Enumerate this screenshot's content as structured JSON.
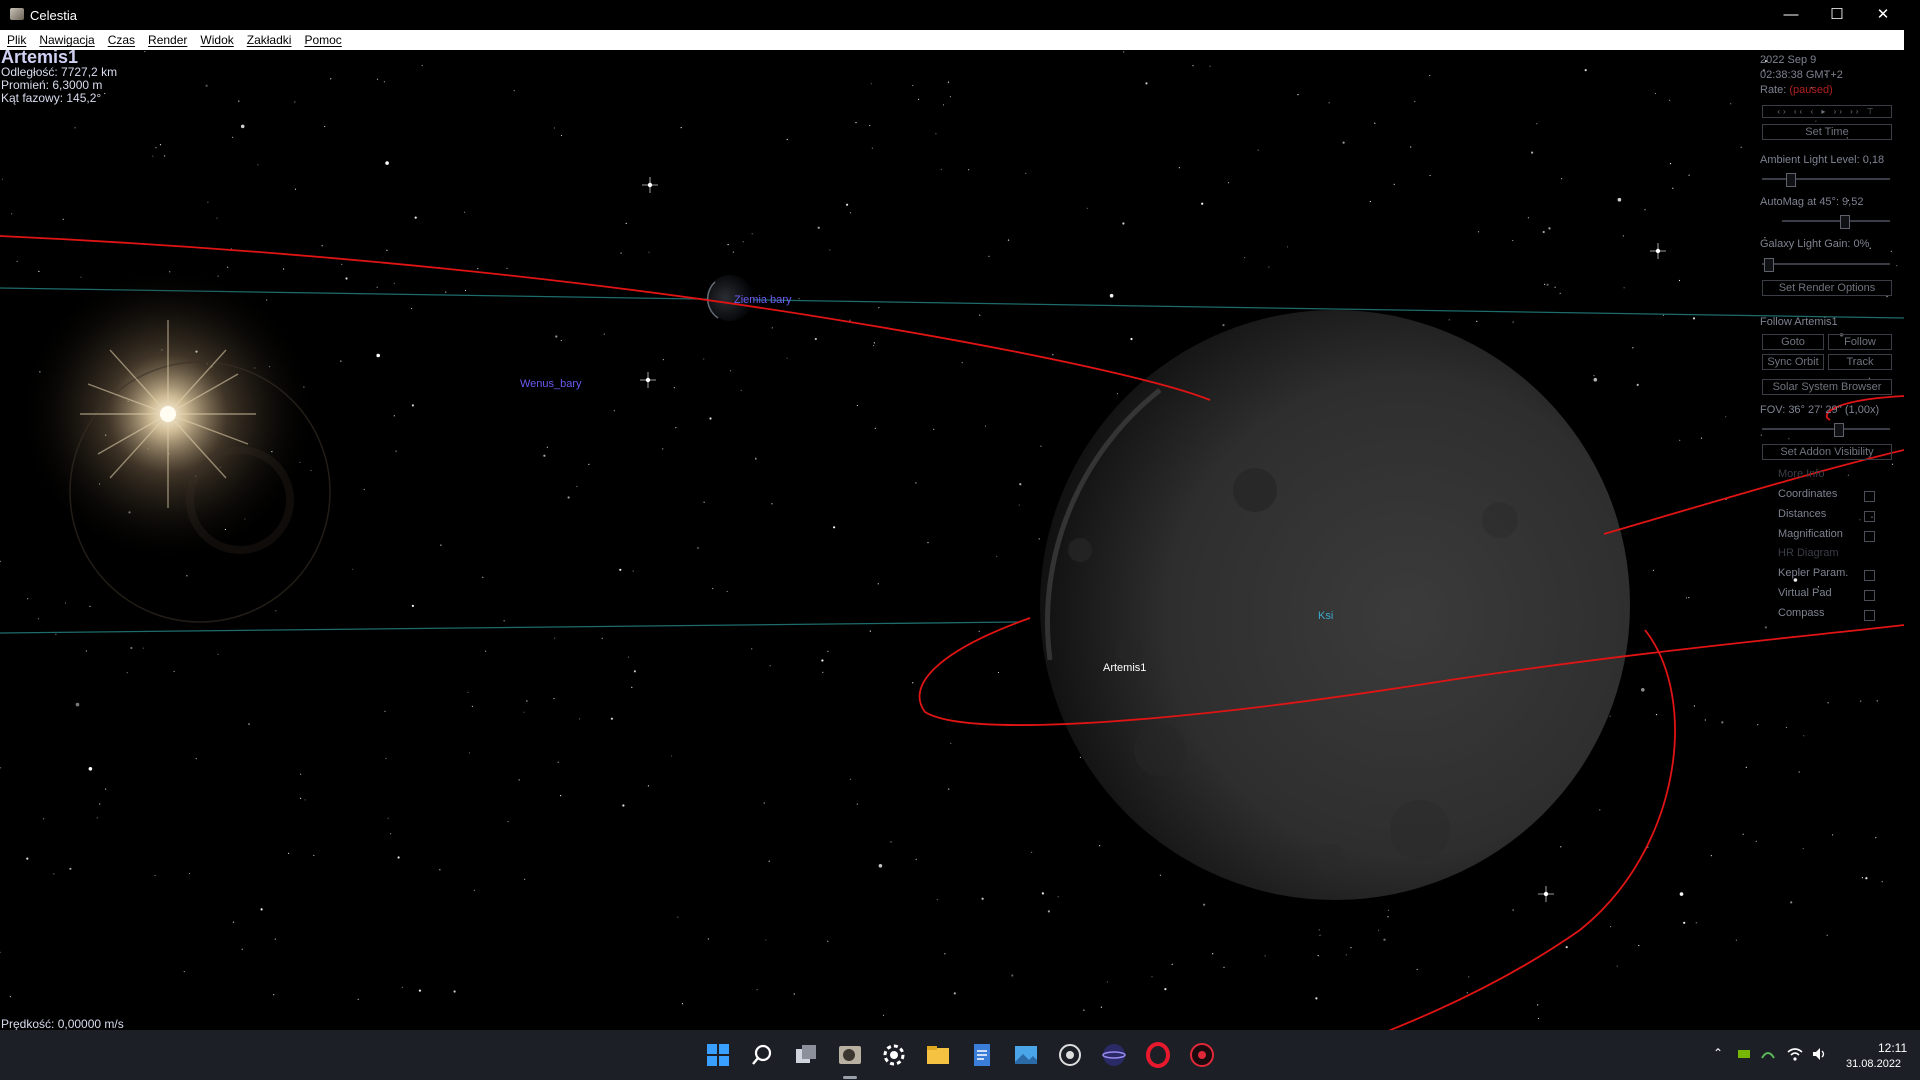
{
  "window": {
    "title": "Celestia",
    "minimize_icon": "minimize-icon",
    "maximize_icon": "maximize-icon",
    "close_icon": "close-icon"
  },
  "menu": [
    "Plik",
    "Nawigacja",
    "Czas",
    "Render",
    "Widok",
    "Zakładki",
    "Pomoc"
  ],
  "selection": {
    "name": "Artemis1",
    "distance": "Odległość: 7727,2 km",
    "radius": "Promień: 6,3000 m",
    "phase": "Kąt fazowy: 145,2°"
  },
  "speed": "Prędkość: 0,00000 m/s",
  "labels": {
    "earth": "Ziemia bary",
    "venus": "Wenus_bary",
    "moon": "Ksi",
    "artemis": "Artemis1"
  },
  "panel": {
    "date": "2022 Sep 9",
    "time": "02:38:38 GMT+2",
    "rate_label": "Rate:",
    "rate_value": "(paused)",
    "set_time": "Set Time",
    "ambient": "Ambient Light Level: 0,18",
    "automag": "AutoMag at 45°: 9,52",
    "galaxy": "Galaxy Light Gain: 0%",
    "render_options": "Set Render Options",
    "follow_title": "Follow Artemis1",
    "goto": "Goto",
    "follow": "Follow",
    "sync_orbit": "Sync Orbit",
    "track": "Track",
    "browser": "Solar System Browser",
    "fov": "FOV: 36° 27' 29'' (1,00x)",
    "addon": "Set Addon Visibility",
    "more_info": "More Info",
    "options": [
      "Coordinates",
      "Distances",
      "Magnification",
      "HR Diagram",
      "Kepler Param.",
      "Virtual Pad",
      "Compass"
    ]
  },
  "clock": {
    "time": "12:11",
    "date": "31.08.2022"
  },
  "colors": {
    "orbit": "#e01414",
    "orbit_cyan": "#1e6b6b",
    "label_blue": "#6a5cf0",
    "moon_label": "#3aa8c8",
    "rate_red": "#b02020"
  }
}
